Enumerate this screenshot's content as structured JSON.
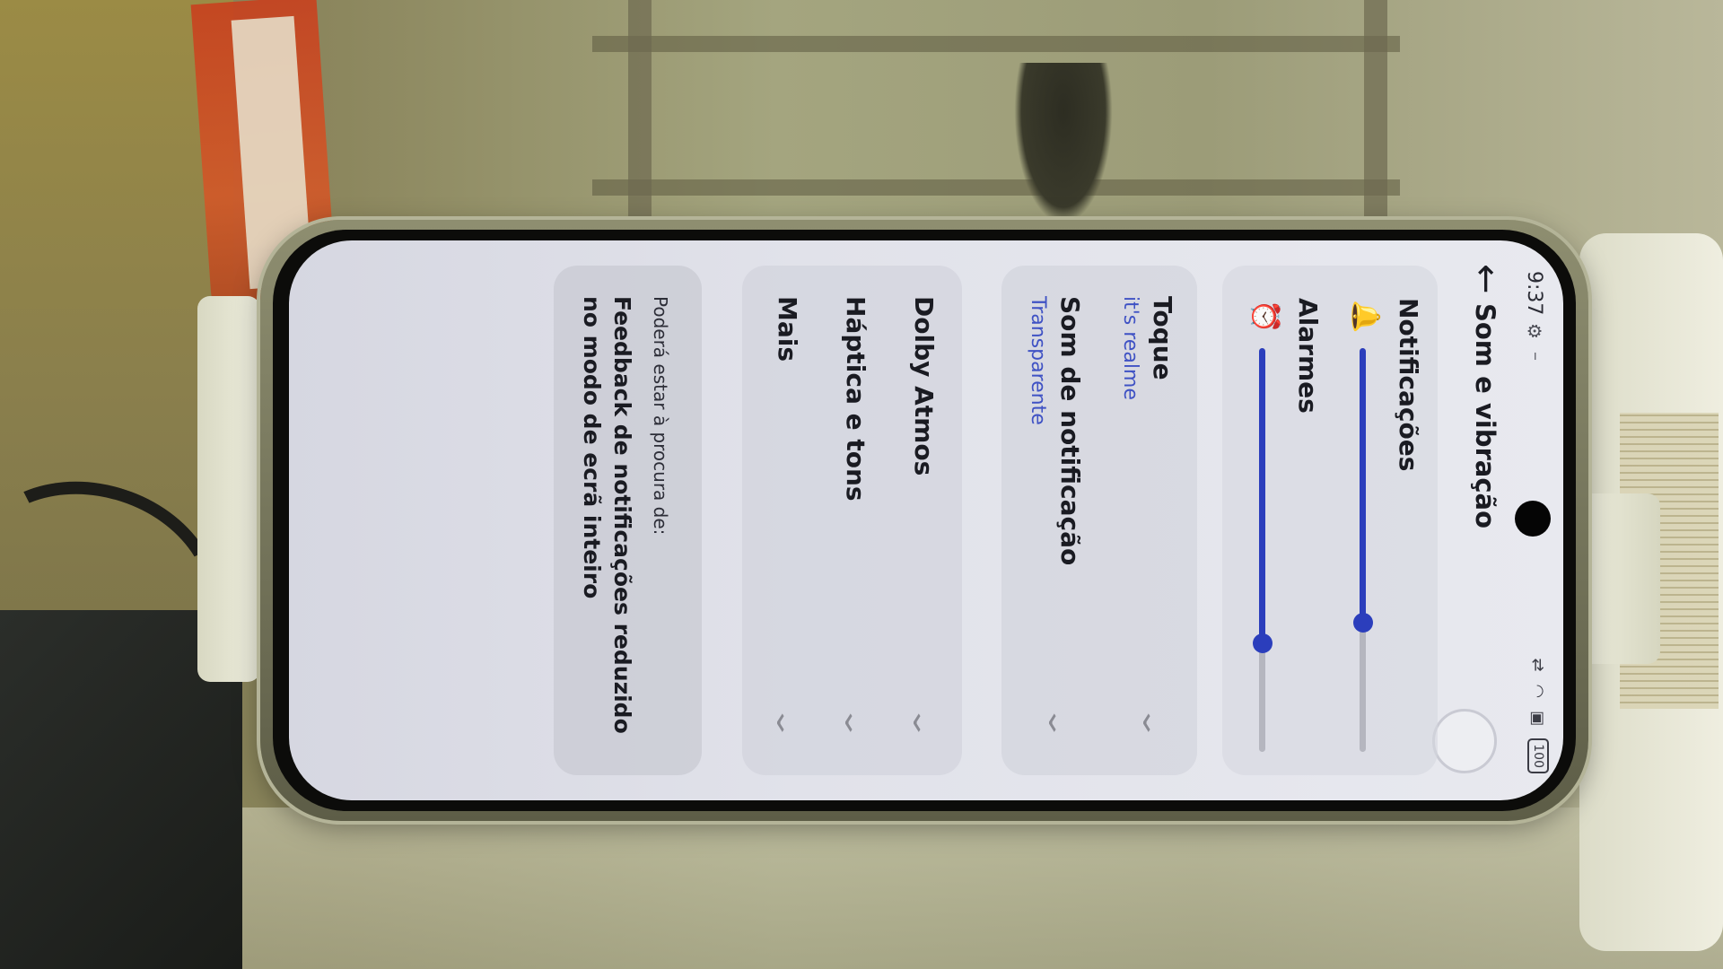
{
  "status_bar": {
    "time": "9:37",
    "battery": "100"
  },
  "header": {
    "back_icon": "arrow-left-icon",
    "title": "Som e vibração"
  },
  "volume": {
    "notifications": {
      "label": "Notificações",
      "icon": "bell-icon",
      "level_percent": 68
    },
    "alarms": {
      "label": "Alarmes",
      "icon": "alarm-clock-icon",
      "level_percent": 73
    }
  },
  "sounds": {
    "ringtone": {
      "title": "Toque",
      "value": "it's realme"
    },
    "notification_sound": {
      "title": "Som de notificação",
      "value": "Transparente"
    }
  },
  "settings": {
    "dolby": {
      "title": "Dolby Atmos"
    },
    "haptics": {
      "title": "Háptica e tons"
    },
    "more": {
      "title": "Mais"
    }
  },
  "suggestion": {
    "caption": "Poderá estar à procura de:",
    "text": "Feedback de notificações reduzido no modo de ecrã inteiro"
  },
  "colors": {
    "accent": "#2b3ebc",
    "value_text": "#3f52c4"
  }
}
